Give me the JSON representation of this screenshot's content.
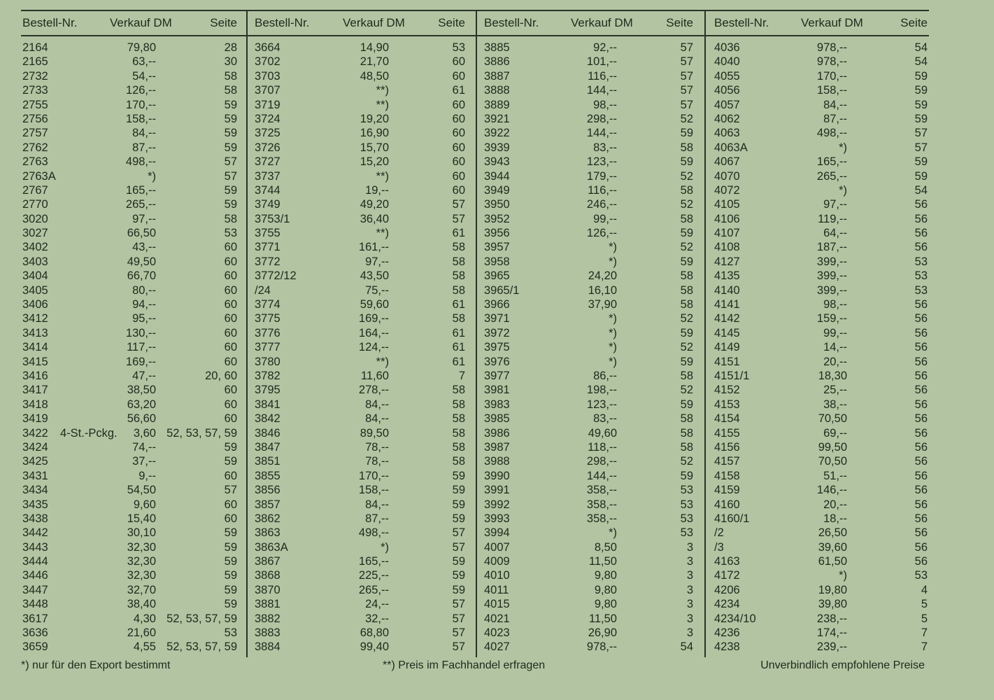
{
  "headers": {
    "order": "Bestell-Nr.",
    "price": "Verkauf DM",
    "page": "Seite"
  },
  "columns": [
    [
      [
        "2164",
        "79,80",
        "28"
      ],
      [
        "2165",
        "63,--",
        "30"
      ],
      [
        "2732",
        "54,--",
        "58"
      ],
      [
        "2733",
        "126,--",
        "58"
      ],
      [
        "2755",
        "170,--",
        "59"
      ],
      [
        "2756",
        "158,--",
        "59"
      ],
      [
        "2757",
        "84,--",
        "59"
      ],
      [
        "2762",
        "87,--",
        "59"
      ],
      [
        "2763",
        "498,--",
        "57"
      ],
      [
        "2763A",
        "*)",
        "57"
      ],
      [
        "2767",
        "165,--",
        "59"
      ],
      [
        "2770",
        "265,--",
        "59"
      ],
      [
        "3020",
        "97,--",
        "58"
      ],
      [
        "3027",
        "66,50",
        "53"
      ],
      [
        "3402",
        "43,--",
        "60"
      ],
      [
        "3403",
        "49,50",
        "60"
      ],
      [
        "3404",
        "66,70",
        "60"
      ],
      [
        "3405",
        "80,--",
        "60"
      ],
      [
        "3406",
        "94,--",
        "60"
      ],
      [
        "3412",
        "95,--",
        "60"
      ],
      [
        "3413",
        "130,--",
        "60"
      ],
      [
        "3414",
        "117,--",
        "60"
      ],
      [
        "3415",
        "169,--",
        "60"
      ],
      [
        "3416",
        "47,--",
        "20, 60"
      ],
      [
        "3417",
        "38,50",
        "60"
      ],
      [
        "3418",
        "63,20",
        "60"
      ],
      [
        "3419",
        "56,60",
        "60"
      ],
      [
        "3422",
        "3,60",
        "52, 53, 57, 59"
      ],
      [
        "3424",
        "74,--",
        "59"
      ],
      [
        "3425",
        "37,--",
        "59"
      ],
      [
        "3431",
        "9,--",
        "60"
      ],
      [
        "3434",
        "54,50",
        "57"
      ],
      [
        "3435",
        "9,60",
        "60"
      ],
      [
        "3438",
        "15,40",
        "60"
      ],
      [
        "3442",
        "30,10",
        "59"
      ],
      [
        "3443",
        "32,30",
        "59"
      ],
      [
        "3444",
        "32,30",
        "59"
      ],
      [
        "3446",
        "32,30",
        "59"
      ],
      [
        "3447",
        "32,70",
        "59"
      ],
      [
        "3448",
        "38,40",
        "59"
      ],
      [
        "3617",
        "4,30",
        "52, 53, 57, 59"
      ],
      [
        "3636",
        "21,60",
        "53"
      ],
      [
        "3659",
        "4,55",
        "52, 53, 57, 59"
      ]
    ],
    [
      [
        "3664",
        "14,90",
        "53"
      ],
      [
        "3702",
        "21,70",
        "60"
      ],
      [
        "3703",
        "48,50",
        "60"
      ],
      [
        "3707",
        "**)",
        "61"
      ],
      [
        "3719",
        "**)",
        "60"
      ],
      [
        "3724",
        "19,20",
        "60"
      ],
      [
        "3725",
        "16,90",
        "60"
      ],
      [
        "3726",
        "15,70",
        "60"
      ],
      [
        "3727",
        "15,20",
        "60"
      ],
      [
        "3737",
        "**)",
        "60"
      ],
      [
        "3744",
        "19,--",
        "60"
      ],
      [
        "3749",
        "49,20",
        "57"
      ],
      [
        "3753/1",
        "36,40",
        "57"
      ],
      [
        "3755",
        "**)",
        "61"
      ],
      [
        "3771",
        "161,--",
        "58"
      ],
      [
        "3772",
        "97,--",
        "58"
      ],
      [
        "3772/12",
        "43,50",
        "58"
      ],
      [
        "/24",
        "75,--",
        "58"
      ],
      [
        "3774",
        "59,60",
        "61"
      ],
      [
        "3775",
        "169,--",
        "58"
      ],
      [
        "3776",
        "164,--",
        "61"
      ],
      [
        "3777",
        "124,--",
        "61"
      ],
      [
        "3780",
        "**)",
        "61"
      ],
      [
        "3782",
        "11,60",
        "7"
      ],
      [
        "3795",
        "278,--",
        "58"
      ],
      [
        "3841",
        "84,--",
        "58"
      ],
      [
        "3842",
        "84,--",
        "58"
      ],
      [
        "3846",
        "89,50",
        "58"
      ],
      [
        "3847",
        "78,--",
        "58"
      ],
      [
        "3851",
        "78,--",
        "58"
      ],
      [
        "3855",
        "170,--",
        "59"
      ],
      [
        "3856",
        "158,--",
        "59"
      ],
      [
        "3857",
        "84,--",
        "59"
      ],
      [
        "3862",
        "87,--",
        "59"
      ],
      [
        "3863",
        "498,--",
        "57"
      ],
      [
        "3863A",
        "*)",
        "57"
      ],
      [
        "3867",
        "165,--",
        "59"
      ],
      [
        "3868",
        "225,--",
        "59"
      ],
      [
        "3870",
        "265,--",
        "59"
      ],
      [
        "3881",
        "24,--",
        "57"
      ],
      [
        "3882",
        "32,--",
        "57"
      ],
      [
        "3883",
        "68,80",
        "57"
      ],
      [
        "3884",
        "99,40",
        "57"
      ]
    ],
    [
      [
        "3885",
        "92,--",
        "57"
      ],
      [
        "3886",
        "101,--",
        "57"
      ],
      [
        "3887",
        "116,--",
        "57"
      ],
      [
        "3888",
        "144,--",
        "57"
      ],
      [
        "3889",
        "98,--",
        "57"
      ],
      [
        "3921",
        "298,--",
        "52"
      ],
      [
        "3922",
        "144,--",
        "59"
      ],
      [
        "3939",
        "83,--",
        "58"
      ],
      [
        "3943",
        "123,--",
        "59"
      ],
      [
        "3944",
        "179,--",
        "52"
      ],
      [
        "3949",
        "116,--",
        "58"
      ],
      [
        "3950",
        "246,--",
        "52"
      ],
      [
        "3952",
        "99,--",
        "58"
      ],
      [
        "3956",
        "126,--",
        "59"
      ],
      [
        "3957",
        "*)",
        "52"
      ],
      [
        "3958",
        "*)",
        "59"
      ],
      [
        "3965",
        "24,20",
        "58"
      ],
      [
        "3965/1",
        "16,10",
        "58"
      ],
      [
        "3966",
        "37,90",
        "58"
      ],
      [
        "3971",
        "*)",
        "52"
      ],
      [
        "3972",
        "*)",
        "59"
      ],
      [
        "3975",
        "*)",
        "52"
      ],
      [
        "3976",
        "*)",
        "59"
      ],
      [
        "3977",
        "86,--",
        "58"
      ],
      [
        "3981",
        "198,--",
        "52"
      ],
      [
        "3983",
        "123,--",
        "59"
      ],
      [
        "3985",
        "83,--",
        "58"
      ],
      [
        "3986",
        "49,60",
        "58"
      ],
      [
        "3987",
        "118,--",
        "58"
      ],
      [
        "3988",
        "298,--",
        "52"
      ],
      [
        "3990",
        "144,--",
        "59"
      ],
      [
        "3991",
        "358,--",
        "53"
      ],
      [
        "3992",
        "358,--",
        "53"
      ],
      [
        "3993",
        "358,--",
        "53"
      ],
      [
        "3994",
        "*)",
        "53"
      ],
      [
        "4007",
        "8,50",
        "3"
      ],
      [
        "4009",
        "11,50",
        "3"
      ],
      [
        "4010",
        "9,80",
        "3"
      ],
      [
        "4011",
        "9,80",
        "3"
      ],
      [
        "4015",
        "9,80",
        "3"
      ],
      [
        "4021",
        "11,50",
        "3"
      ],
      [
        "4023",
        "26,90",
        "3"
      ],
      [
        "4027",
        "978,--",
        "54"
      ]
    ],
    [
      [
        "4036",
        "978,--",
        "54"
      ],
      [
        "4040",
        "978,--",
        "54"
      ],
      [
        "4055",
        "170,--",
        "59"
      ],
      [
        "4056",
        "158,--",
        "59"
      ],
      [
        "4057",
        "84,--",
        "59"
      ],
      [
        "4062",
        "87,--",
        "59"
      ],
      [
        "4063",
        "498,--",
        "57"
      ],
      [
        "4063A",
        "*)",
        "57"
      ],
      [
        "4067",
        "165,--",
        "59"
      ],
      [
        "4070",
        "265,--",
        "59"
      ],
      [
        "4072",
        "*)",
        "54"
      ],
      [
        "4105",
        "97,--",
        "56"
      ],
      [
        "4106",
        "119,--",
        "56"
      ],
      [
        "4107",
        "64,--",
        "56"
      ],
      [
        "4108",
        "187,--",
        "56"
      ],
      [
        "4127",
        "399,--",
        "53"
      ],
      [
        "4135",
        "399,--",
        "53"
      ],
      [
        "4140",
        "399,--",
        "53"
      ],
      [
        "4141",
        "98,--",
        "56"
      ],
      [
        "4142",
        "159,--",
        "56"
      ],
      [
        "4145",
        "99,--",
        "56"
      ],
      [
        "4149",
        "14,--",
        "56"
      ],
      [
        "4151",
        "20,--",
        "56"
      ],
      [
        "4151/1",
        "18,30",
        "56"
      ],
      [
        "4152",
        "25,--",
        "56"
      ],
      [
        "4153",
        "38,--",
        "56"
      ],
      [
        "4154",
        "70,50",
        "56"
      ],
      [
        "4155",
        "69,--",
        "56"
      ],
      [
        "4156",
        "99,50",
        "56"
      ],
      [
        "4157",
        "70,50",
        "56"
      ],
      [
        "4158",
        "51,--",
        "56"
      ],
      [
        "4159",
        "146,--",
        "56"
      ],
      [
        "4160",
        "20,--",
        "56"
      ],
      [
        "4160/1",
        "18,--",
        "56"
      ],
      [
        "/2",
        "26,50",
        "56"
      ],
      [
        "/3",
        "39,60",
        "56"
      ],
      [
        "4163",
        "61,50",
        "56"
      ],
      [
        "4172",
        "*)",
        "53"
      ],
      [
        "4206",
        "19,80",
        "4"
      ],
      [
        "4234",
        "39,80",
        "5"
      ],
      [
        "4234/10",
        "238,--",
        "5"
      ],
      [
        "4236",
        "174,--",
        "7"
      ],
      [
        "4238",
        "239,--",
        "7"
      ]
    ]
  ],
  "notes": {
    "row_3422_label": "4-St.-Pckg."
  },
  "footer": {
    "export_note": "*) nur für den Export bestimmt",
    "dealer_note": "**) Preis im Fachhandel erfragen",
    "prices_note": "Unverbindlich empfohlene Preise"
  }
}
